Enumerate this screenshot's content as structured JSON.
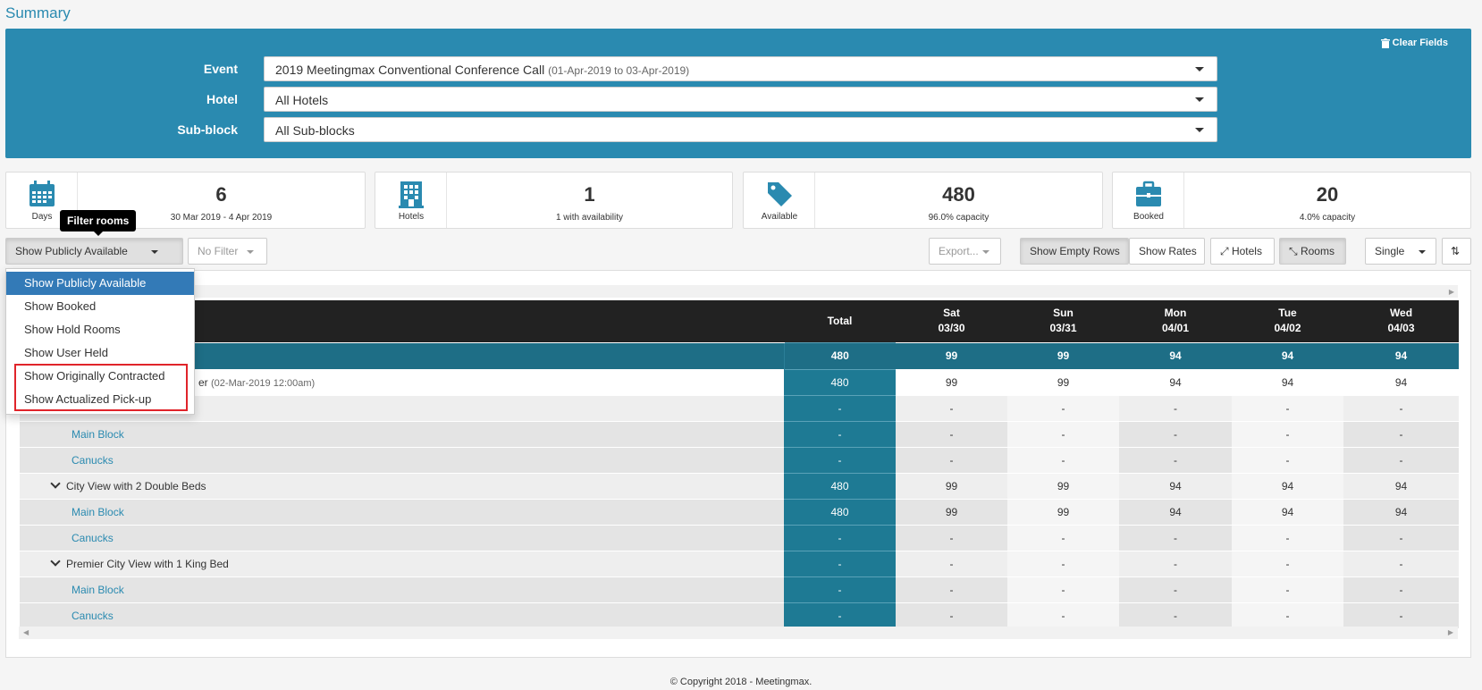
{
  "page_title": "Summary",
  "filters": {
    "clear_label": "Clear Fields",
    "event_label": "Event",
    "event_value": "2019 Meetingmax Conventional Conference Call",
    "event_dates": "(01-Apr-2019 to 03-Apr-2019)",
    "hotel_label": "Hotel",
    "hotel_value": "All Hotels",
    "subblock_label": "Sub-block",
    "subblock_value": "All Sub-blocks"
  },
  "stats": [
    {
      "icon": "calendar-icon",
      "label": "Days",
      "value": "6",
      "sub": "30 Mar 2019 - 4 Apr 2019"
    },
    {
      "icon": "building-icon",
      "label": "Hotels",
      "value": "1",
      "sub": "1 with availability"
    },
    {
      "icon": "tag-icon",
      "label": "Available",
      "value": "480",
      "sub": "96.0% capacity"
    },
    {
      "icon": "briefcase-icon",
      "label": "Booked",
      "value": "20",
      "sub": "4.0% capacity"
    }
  ],
  "tooltip": "Filter rooms",
  "toolbar": {
    "filter_select": "Show Publicly Available",
    "no_filter": "No Filter",
    "export": "Export...",
    "show_empty_rows": "Show Empty Rows",
    "show_rates": "Show Rates",
    "hotels": "Hotels",
    "rooms": "Rooms",
    "occupancy": "Single"
  },
  "dropdown_items": [
    "Show Publicly Available",
    "Show Booked",
    "Show Hold Rooms",
    "Show User Held",
    "Show Originally Contracted",
    "Show Actualized Pick-up"
  ],
  "table": {
    "total_header": "Total",
    "days": [
      {
        "day": "Sat",
        "date": "03/30"
      },
      {
        "day": "Sun",
        "date": "03/31"
      },
      {
        "day": "Mon",
        "date": "04/01"
      },
      {
        "day": "Tue",
        "date": "04/02"
      },
      {
        "day": "Wed",
        "date": "04/03"
      }
    ],
    "grand_total": {
      "total": "480",
      "values": [
        "99",
        "99",
        "94",
        "94",
        "94"
      ]
    },
    "hotel_row": {
      "name_visible": "er",
      "date": "(02-Mar-2019 12:00am)",
      "total": "480",
      "values": [
        "99",
        "99",
        "94",
        "94",
        "94"
      ]
    },
    "rows": [
      {
        "type": "room",
        "name": "",
        "total": "-",
        "values": [
          "-",
          "-",
          "-",
          "-",
          "-"
        ]
      },
      {
        "type": "sub",
        "name": "Main Block",
        "total": "-",
        "values": [
          "-",
          "-",
          "-",
          "-",
          "-"
        ]
      },
      {
        "type": "sub",
        "name": "Canucks",
        "total": "-",
        "values": [
          "-",
          "-",
          "-",
          "-",
          "-"
        ]
      },
      {
        "type": "room",
        "name": "City View with 2 Double Beds",
        "total": "480",
        "values": [
          "99",
          "99",
          "94",
          "94",
          "94"
        ]
      },
      {
        "type": "sub",
        "name": "Main Block",
        "total": "480",
        "values": [
          "99",
          "99",
          "94",
          "94",
          "94"
        ]
      },
      {
        "type": "sub",
        "name": "Canucks",
        "total": "-",
        "values": [
          "-",
          "-",
          "-",
          "-",
          "-"
        ]
      },
      {
        "type": "room",
        "name": "Premier City View with 1 King Bed",
        "total": "-",
        "values": [
          "-",
          "-",
          "-",
          "-",
          "-"
        ]
      },
      {
        "type": "sub",
        "name": "Main Block",
        "total": "-",
        "values": [
          "-",
          "-",
          "-",
          "-",
          "-"
        ]
      },
      {
        "type": "sub",
        "name": "Canucks",
        "total": "-",
        "values": [
          "-",
          "-",
          "-",
          "-",
          "-"
        ]
      }
    ]
  },
  "footer": "© Copyright 2018 - Meetingmax."
}
